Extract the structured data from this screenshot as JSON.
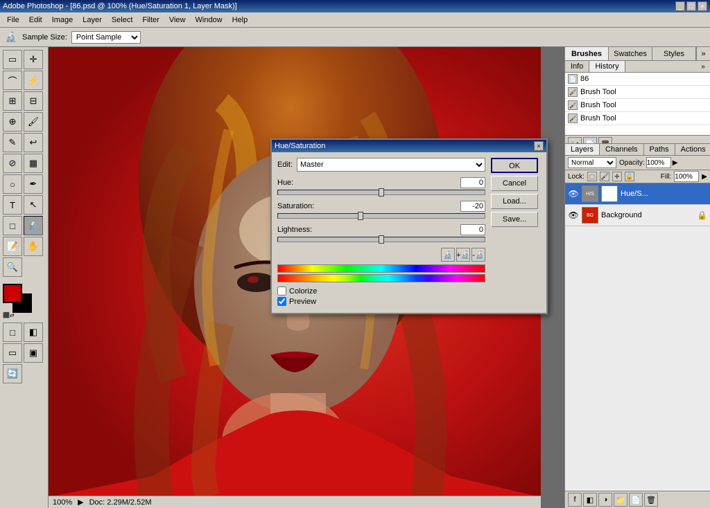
{
  "titlebar": {
    "title": "Adobe Photoshop - [86.psd @ 100% (Hue/Saturation 1, Layer Mask)]",
    "controls": [
      "minimize",
      "maximize",
      "close"
    ]
  },
  "menu": {
    "items": [
      "File",
      "Edit",
      "Image",
      "Layer",
      "Select",
      "Filter",
      "View",
      "Window",
      "Help"
    ]
  },
  "options_bar": {
    "tool_label": "🔬",
    "sample_size_label": "Sample Size:",
    "sample_size_value": "Point Sample"
  },
  "right_panel": {
    "top_tabs": [
      "Brushes",
      "Swatches",
      "Styles"
    ],
    "active_top_tab": "Brushes",
    "history_tabs": [
      "Info",
      "History"
    ],
    "active_history_tab": "History",
    "history_items": [
      {
        "label": "86",
        "icon": "📄"
      },
      {
        "label": "Brush Tool",
        "icon": "🖌"
      },
      {
        "label": "Brush Tool",
        "icon": "🖌"
      },
      {
        "label": "Brush Tool",
        "icon": "🖌"
      }
    ],
    "layers_tabs": [
      "Layers",
      "Channels",
      "Paths",
      "Actions"
    ],
    "active_layers_tab": "Layers",
    "blend_mode": "Normal",
    "opacity_label": "Opacity:",
    "opacity_value": "100%",
    "fill_label": "Fill:",
    "fill_value": "100%",
    "lock_label": "Lock:",
    "layers": [
      {
        "name": "Hue/S...",
        "visible": true,
        "type": "adjustment",
        "active": true
      },
      {
        "name": "Background",
        "visible": true,
        "type": "image",
        "active": false,
        "locked": true
      }
    ]
  },
  "hue_saturation_dialog": {
    "title": "Hue/Saturation",
    "edit_label": "Edit:",
    "edit_value": "Master",
    "hue_label": "Hue:",
    "hue_value": "0",
    "hue_slider_pct": 50,
    "saturation_label": "Saturation:",
    "saturation_value": "-20",
    "saturation_slider_pct": 40,
    "lightness_label": "Lightness:",
    "lightness_value": "0",
    "lightness_slider_pct": 50,
    "buttons": {
      "ok": "OK",
      "cancel": "Cancel",
      "load": "Load...",
      "save": "Save..."
    },
    "colorize_label": "Colorize",
    "preview_label": "Preview",
    "colorize_checked": false,
    "preview_checked": true
  },
  "status_bar": {
    "zoom": "100%",
    "doc_info": "Doc: 2.29M/2.52M"
  }
}
